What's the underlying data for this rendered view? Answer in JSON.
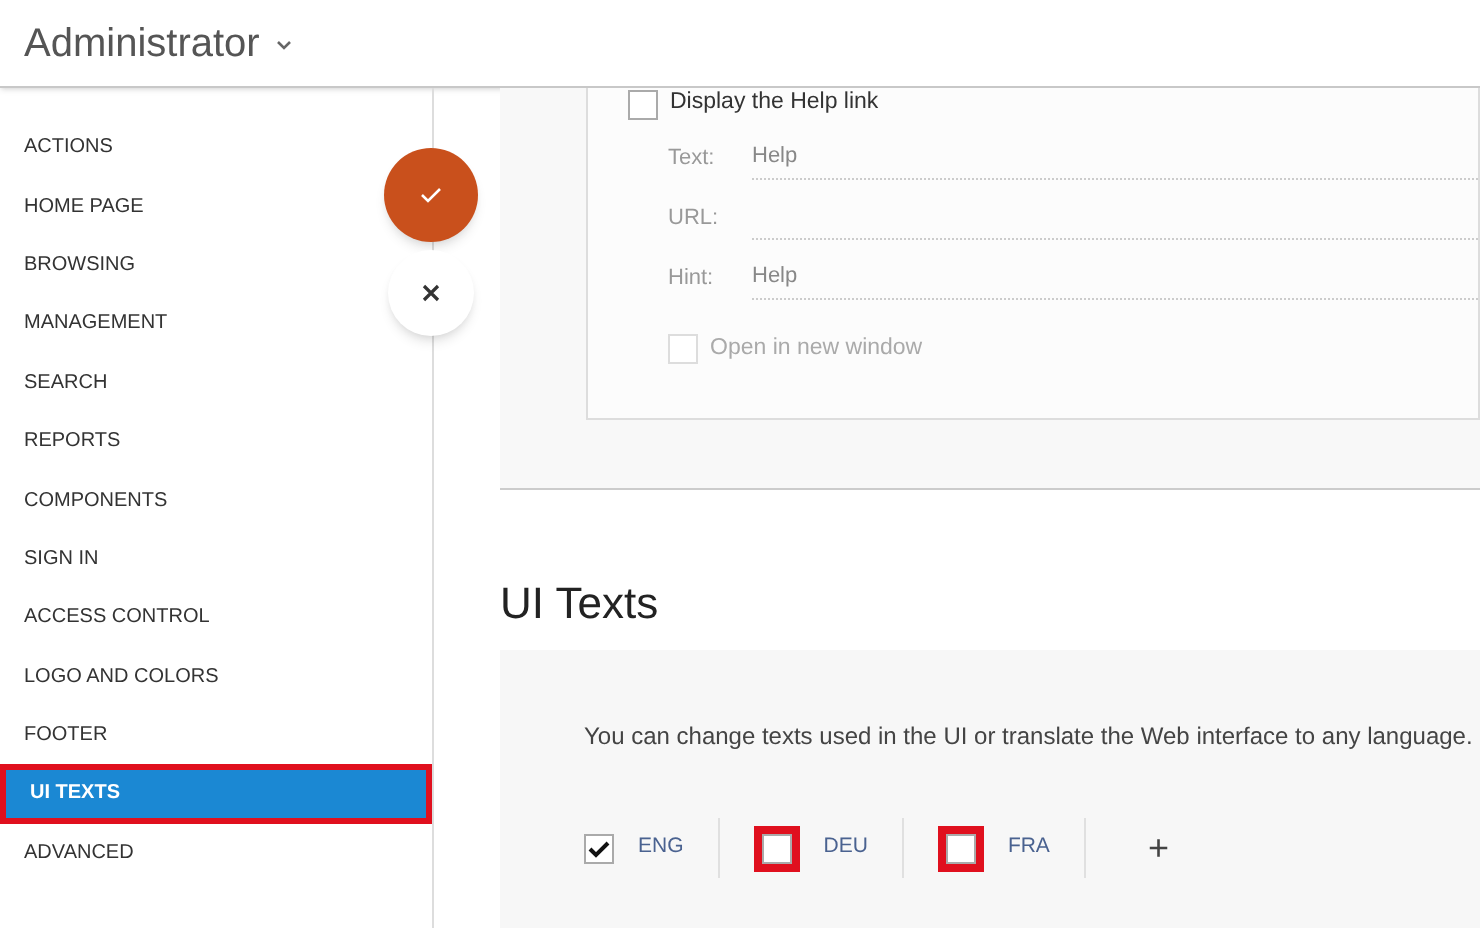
{
  "header": {
    "title": "Administrator"
  },
  "sidebar": {
    "items": [
      {
        "label": "ACTIONS",
        "selected": false,
        "highlighted": false
      },
      {
        "label": "HOME PAGE",
        "selected": false,
        "highlighted": false
      },
      {
        "label": "BROWSING",
        "selected": false,
        "highlighted": false
      },
      {
        "label": "MANAGEMENT",
        "selected": false,
        "highlighted": false
      },
      {
        "label": "SEARCH",
        "selected": false,
        "highlighted": false
      },
      {
        "label": "REPORTS",
        "selected": false,
        "highlighted": false
      },
      {
        "label": "COMPONENTS",
        "selected": false,
        "highlighted": false
      },
      {
        "label": "SIGN IN",
        "selected": false,
        "highlighted": false
      },
      {
        "label": "ACCESS CONTROL",
        "selected": false,
        "highlighted": false
      },
      {
        "label": "LOGO AND COLORS",
        "selected": false,
        "highlighted": false
      },
      {
        "label": "FOOTER",
        "selected": false,
        "highlighted": false
      },
      {
        "label": "UI TEXTS",
        "selected": true,
        "highlighted": true
      },
      {
        "label": "ADVANCED",
        "selected": false,
        "highlighted": false
      }
    ]
  },
  "help_link": {
    "label": "Display the Help link",
    "checked": false,
    "fields": [
      {
        "label": "Text:",
        "value": "Help"
      },
      {
        "label": "URL:"
      },
      {
        "label": "Hint:",
        "value": "Help"
      }
    ],
    "new_window": {
      "label": "Open in new window",
      "checked": false,
      "disabled": true
    }
  },
  "ui_texts": {
    "heading": "UI Texts",
    "description": "You can change texts used in the UI or translate the Web interface to any language.",
    "languages": [
      {
        "label": "ENG",
        "checked": true,
        "highlighted": false
      },
      {
        "label": "DEU",
        "checked": false,
        "highlighted": true
      },
      {
        "label": "FRA",
        "checked": false,
        "highlighted": true
      }
    ],
    "add_label": "+"
  }
}
